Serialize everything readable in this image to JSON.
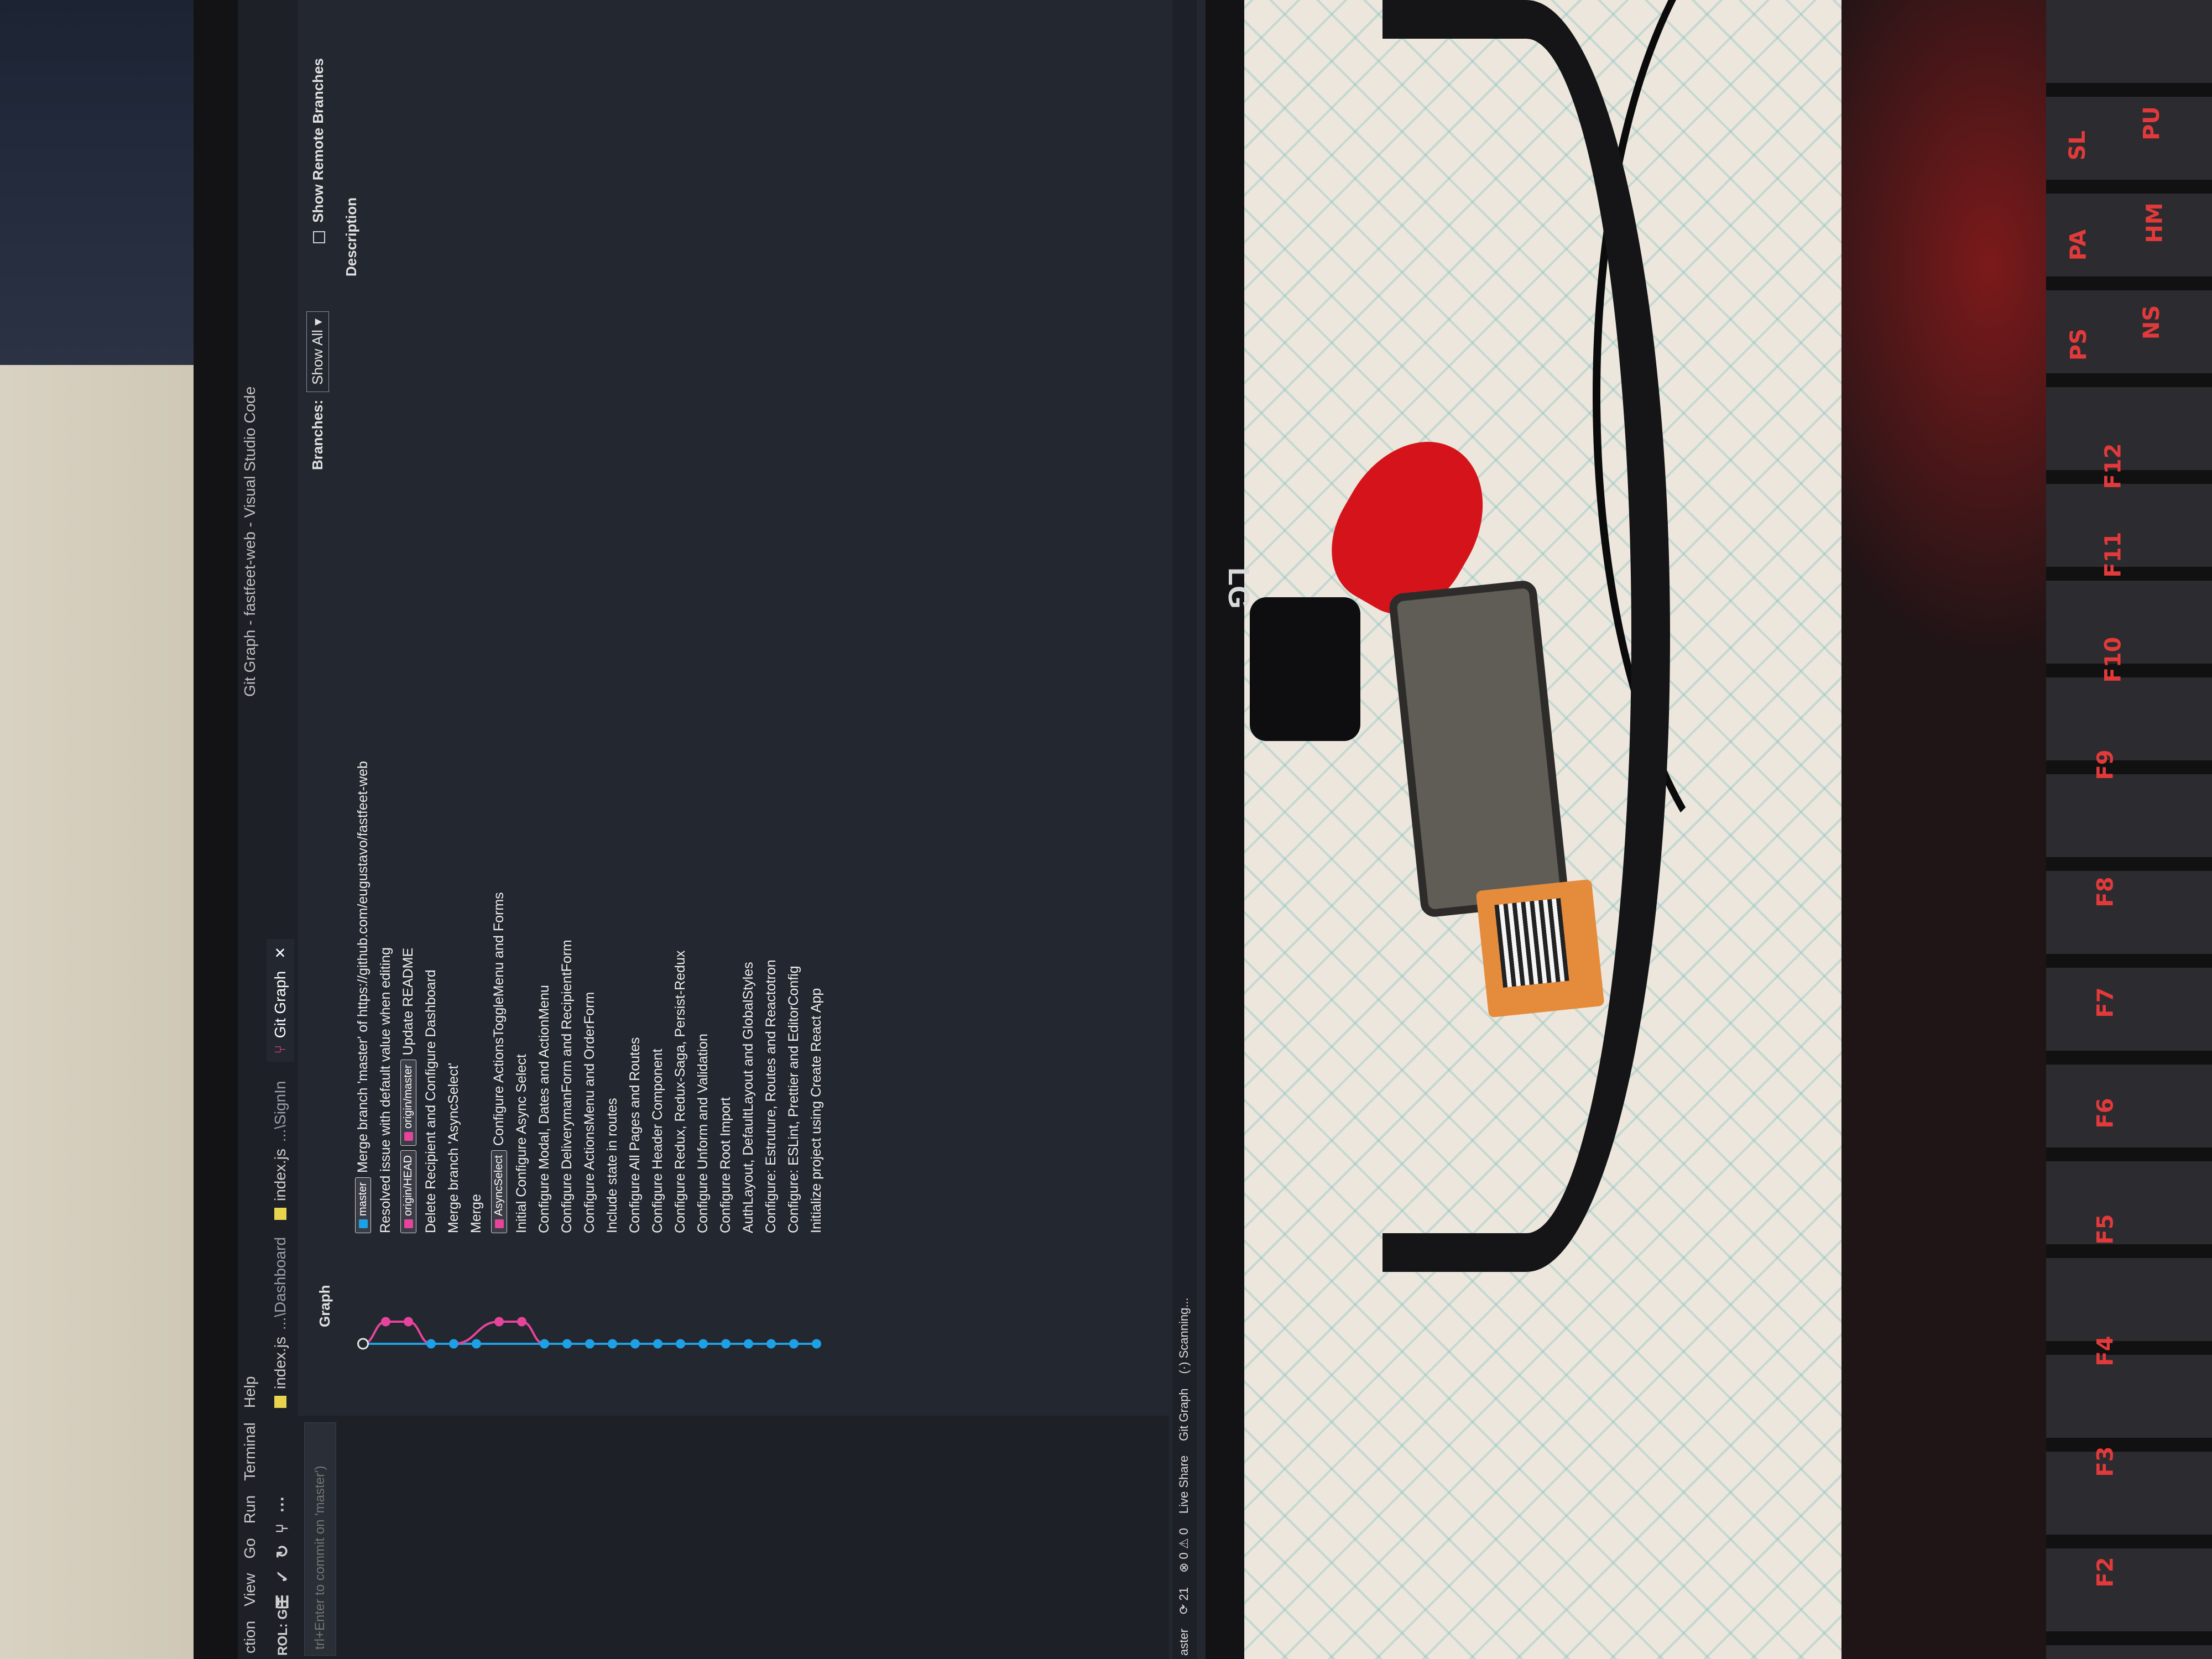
{
  "window": {
    "title": "Git Graph - fastfeet-web - Visual Studio Code"
  },
  "menu": [
    "ction",
    "View",
    "Go",
    "Run",
    "Terminal",
    "Help"
  ],
  "sidebar": {
    "header": "ROL: GIT",
    "commit_placeholder": "trl+Enter to commit on 'master')"
  },
  "tabs": [
    {
      "label": "index.js",
      "path": "...\\Dashboard"
    },
    {
      "label": "index.js",
      "path": "...\\SignIn"
    },
    {
      "label": "Git Graph",
      "active": true
    }
  ],
  "graph_header": {
    "graph": "Graph",
    "description": "Description",
    "branches_label": "Branches:",
    "branches_value": "Show All",
    "remote_branches": "Show Remote Branches"
  },
  "commits": [
    {
      "tags": [
        {
          "text": "master",
          "color": "#1ea0e6"
        }
      ],
      "message": "Merge branch 'master' of https://github.com/eugustavo/fastfeet-web"
    },
    {
      "tags": [],
      "message": "Resolved issue with default value when editing"
    },
    {
      "tags": [
        {
          "text": "origin/HEAD",
          "color": "#e6449a"
        },
        {
          "text": "origin/master",
          "color": "#e6449a"
        }
      ],
      "message": "Update README"
    },
    {
      "tags": [],
      "message": "Delete Recipient and Configure Dashboard"
    },
    {
      "tags": [],
      "message": "Merge branch 'AsyncSelect'"
    },
    {
      "tags": [],
      "message": "Merge"
    },
    {
      "tags": [
        {
          "text": "AsyncSelect",
          "color": "#e6449a"
        }
      ],
      "message": "Configure ActionsToggleMenu and Forms"
    },
    {
      "tags": [],
      "message": "Initial Configure Async Select"
    },
    {
      "tags": [],
      "message": "Configure Modal, Dates and ActionMenu"
    },
    {
      "tags": [],
      "message": "Configure DeliverymanForm and RecipientForm"
    },
    {
      "tags": [],
      "message": "Configure ActionsMenu and OrderForm"
    },
    {
      "tags": [],
      "message": "Include state in routes"
    },
    {
      "tags": [],
      "message": "Configure All Pages and Routes"
    },
    {
      "tags": [],
      "message": "Configure Header Component"
    },
    {
      "tags": [],
      "message": "Configure Redux, Redux-Saga, Persist-Redux"
    },
    {
      "tags": [],
      "message": "Configure Unform and Validation"
    },
    {
      "tags": [],
      "message": "Configure Root Import"
    },
    {
      "tags": [],
      "message": "AuthLayout, DefaultLayout and GlobalStyles"
    },
    {
      "tags": [],
      "message": "Configure: Estruture, Routes and Reactotron"
    },
    {
      "tags": [],
      "message": "Configure: ESLint, Prettier and EditorConfig"
    },
    {
      "tags": [],
      "message": "Initialize project using Create React App"
    }
  ],
  "statusbar": [
    "aster",
    "⟳ 21",
    "⊗ 0 ⚠ 0",
    "Live Share",
    "Git Graph",
    "(·) Scanning..."
  ],
  "monitor_brand": "LG",
  "keyboard_keys": [
    "F2",
    "F3",
    "F4",
    "F5",
    "F6",
    "F7",
    "F8",
    "F9",
    "F10",
    "F11",
    "F12",
    "PS",
    "PA",
    "SL",
    "PU",
    "HM",
    "NS"
  ],
  "colors": {
    "branch_main": "#1ea0e6",
    "branch_side": "#e6449a"
  }
}
